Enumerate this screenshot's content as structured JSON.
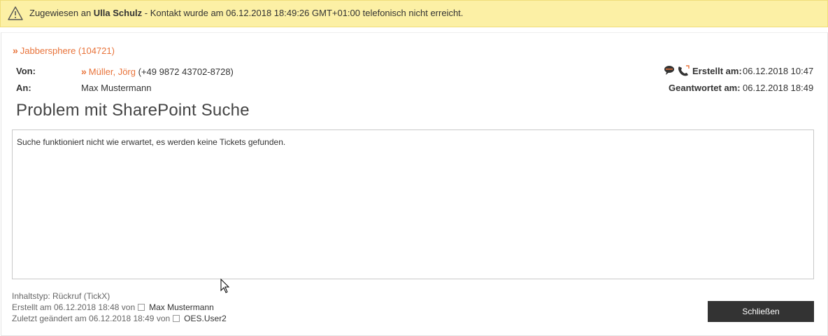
{
  "banner": {
    "prefix": "Zugewiesen an",
    "assignee": "Ulla Schulz",
    "message": "- Kontakt wurde am 06.12.2018 18:49:26 GMT+01:00 telefonisch nicht erreicht."
  },
  "organization": {
    "label": "Jabbersphere (104721)"
  },
  "from": {
    "label": "Von:",
    "name": "Müller, Jörg",
    "phone": "(+49 9872 43702-8728)"
  },
  "to": {
    "label": "An:",
    "name": "Max Mustermann"
  },
  "created": {
    "label": "Erstellt am:",
    "value": "06.12.2018 10:47"
  },
  "answered": {
    "label": "Geantwortet am:",
    "value": "06.12.2018 18:49"
  },
  "subject": "Problem mit SharePoint Suche",
  "body": "Suche funktioniert nicht wie erwartet, es werden keine Tickets gefunden.",
  "footer": {
    "content_type": "Inhaltstyp: Rückruf (TickX)",
    "created_prefix": "Erstellt am 06.12.2018 18:48 von",
    "created_user": "Max Mustermann",
    "modified_prefix": "Zuletzt geändert am 06.12.2018 18:49 von",
    "modified_user": "OES.User2"
  },
  "buttons": {
    "close": "Schließen"
  },
  "colors": {
    "banner": "#fcf0a5",
    "link": "#e8733a",
    "button": "#333333"
  }
}
